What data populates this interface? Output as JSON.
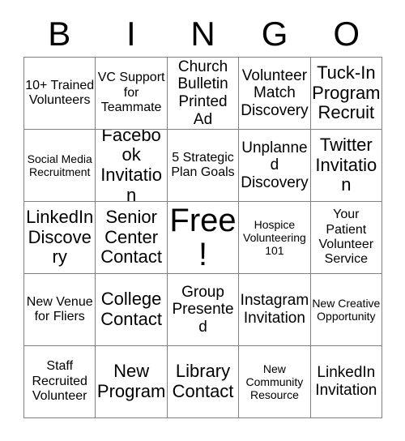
{
  "card": {
    "title": "BINGO",
    "headers": [
      "B",
      "I",
      "N",
      "G",
      "O"
    ],
    "free_space_label": "Free!",
    "colors": {
      "border": "#808080",
      "text": "#000000",
      "background": "#ffffff"
    },
    "rows": [
      [
        {
          "text": "10+ Trained Volunteers",
          "size": "sm"
        },
        {
          "text": "VC Support for Teammate",
          "size": "sm"
        },
        {
          "text": "Church Bulletin Printed Ad",
          "size": "md"
        },
        {
          "text": "Volunteer Match Discovery",
          "size": "md"
        },
        {
          "text": "Tuck-In Program Recruit",
          "size": "lg"
        }
      ],
      [
        {
          "text": "Social Media Recruitment",
          "size": "xs"
        },
        {
          "text": "Facebook Invitation",
          "size": "lg"
        },
        {
          "text": "5 Strategic Plan Goals",
          "size": "sm"
        },
        {
          "text": "Unplanned Discovery",
          "size": "md"
        },
        {
          "text": "Twitter Invitation",
          "size": "lg"
        }
      ],
      [
        {
          "text": "LinkedIn Discovery",
          "size": "lg"
        },
        {
          "text": "Senior Center Contact",
          "size": "lg"
        },
        {
          "text": "Free!",
          "size": "xl"
        },
        {
          "text": "Hospice Volunteering 101",
          "size": "xs"
        },
        {
          "text": "Your Patient Volunteer Service",
          "size": "sm"
        }
      ],
      [
        {
          "text": "New Venue for Fliers",
          "size": "sm"
        },
        {
          "text": "College Contact",
          "size": "lg"
        },
        {
          "text": "Group Presented",
          "size": "md"
        },
        {
          "text": "Instagram Invitation",
          "size": "md"
        },
        {
          "text": "New Creative Opportunity",
          "size": "xs"
        }
      ],
      [
        {
          "text": "Staff Recruited Volunteer",
          "size": "sm"
        },
        {
          "text": "New Program",
          "size": "lg"
        },
        {
          "text": "Library Contact",
          "size": "lg"
        },
        {
          "text": "New Community Resource",
          "size": "xs"
        },
        {
          "text": "LinkedIn Invitation",
          "size": "md"
        }
      ]
    ]
  }
}
